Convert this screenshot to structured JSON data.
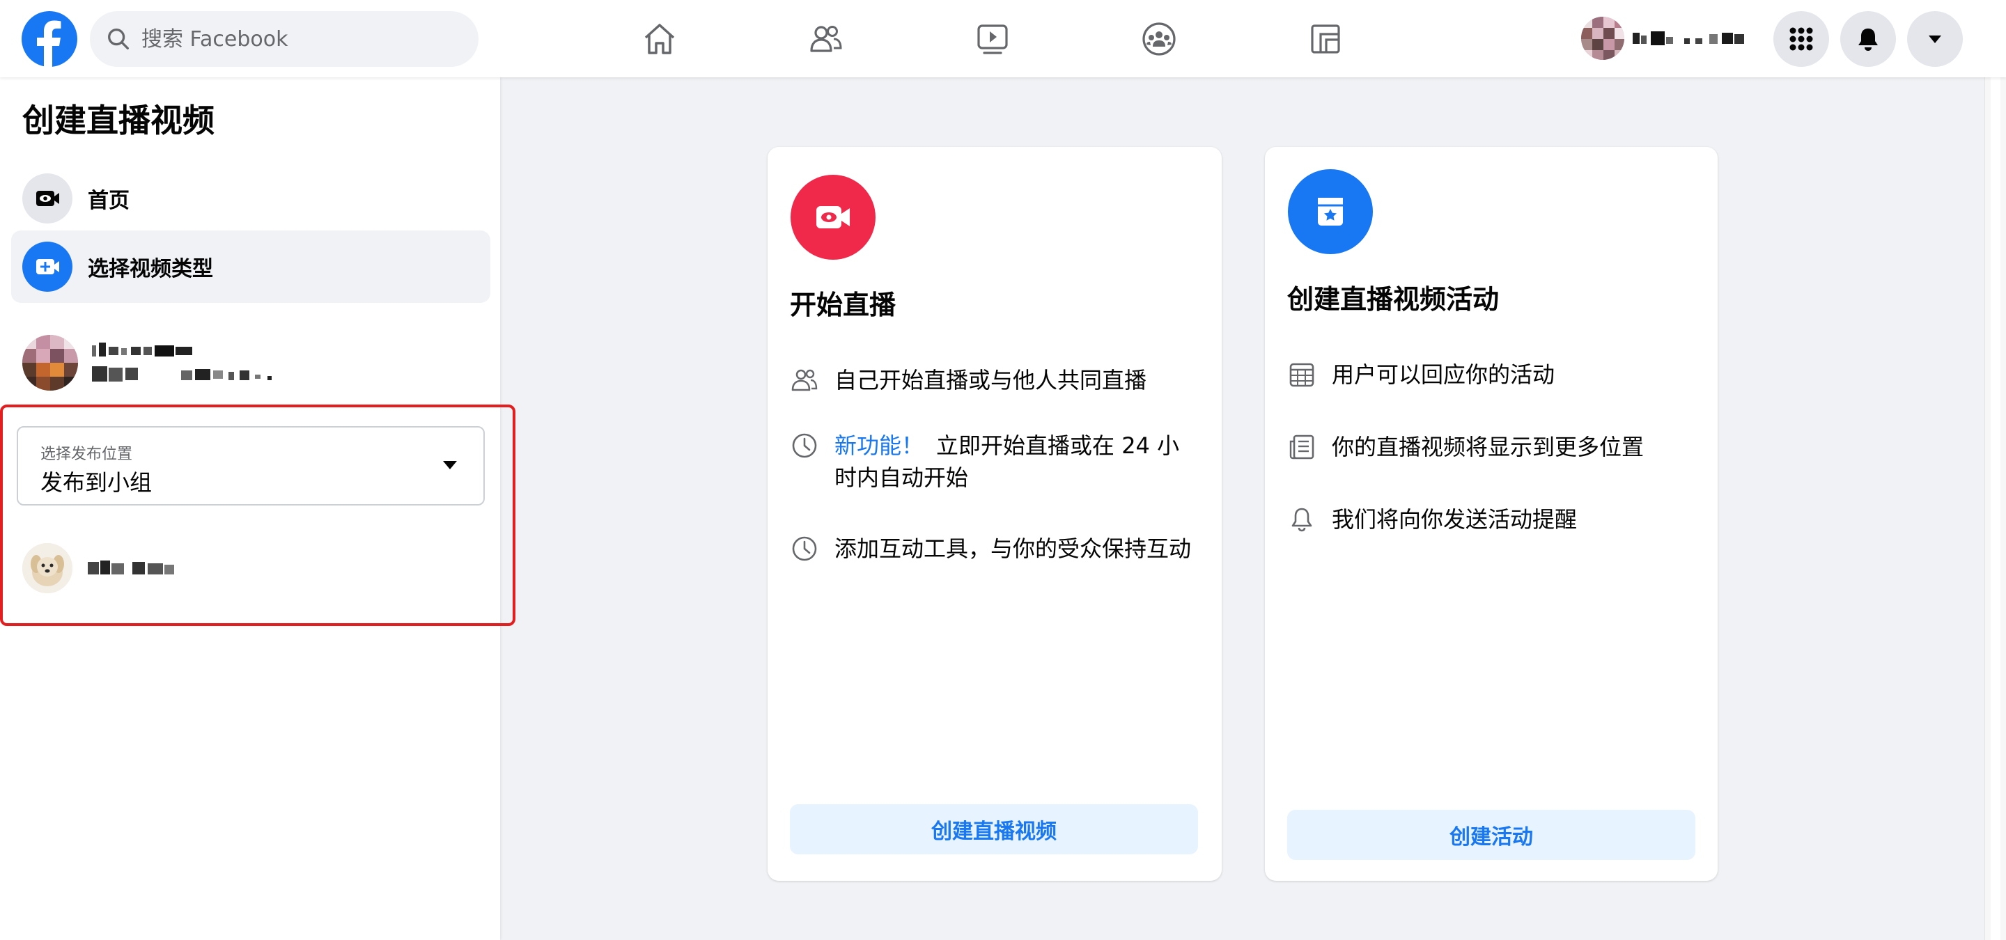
{
  "colors": {
    "brand": "#1877f2",
    "live_red": "#f02849",
    "highlight_box": "#e41e1e",
    "button_bg": "#e7f3ff"
  },
  "header": {
    "search_placeholder": "搜索 Facebook",
    "nav_icons": [
      "home-icon",
      "friends-icon",
      "watch-icon",
      "groups-icon",
      "gaming-icon"
    ],
    "action_icons": [
      "menu-grid-icon",
      "notifications-icon",
      "account-dropdown-icon"
    ]
  },
  "sidebar": {
    "title": "创建直播视频",
    "items": [
      {
        "label": "首页",
        "icon": "live-eye-icon"
      },
      {
        "label": "选择视频类型",
        "icon": "add-video-icon"
      }
    ],
    "select": {
      "label": "选择发布位置",
      "value": "发布到小组"
    }
  },
  "cards": [
    {
      "icon": "live-camera-icon",
      "title": "开始直播",
      "features": [
        {
          "icon": "people-icon",
          "highlight": "",
          "text": "自己开始直播或与他人共同直播"
        },
        {
          "icon": "clock-icon",
          "highlight": "新功能！",
          "text": "立即开始直播或在 24 小时内自动开始"
        },
        {
          "icon": "clock-icon",
          "highlight": "",
          "text": "添加互动工具，与你的受众保持互动"
        }
      ],
      "button": "创建直播视频"
    },
    {
      "icon": "calendar-star-icon",
      "title": "创建直播视频活动",
      "features": [
        {
          "icon": "calendar-grid-icon",
          "highlight": "",
          "text": "用户可以回应你的活动"
        },
        {
          "icon": "news-feed-icon",
          "highlight": "",
          "text": "你的直播视频将显示到更多位置"
        },
        {
          "icon": "bell-icon",
          "highlight": "",
          "text": "我们将向你发送活动提醒"
        }
      ],
      "button": "创建活动"
    }
  ]
}
